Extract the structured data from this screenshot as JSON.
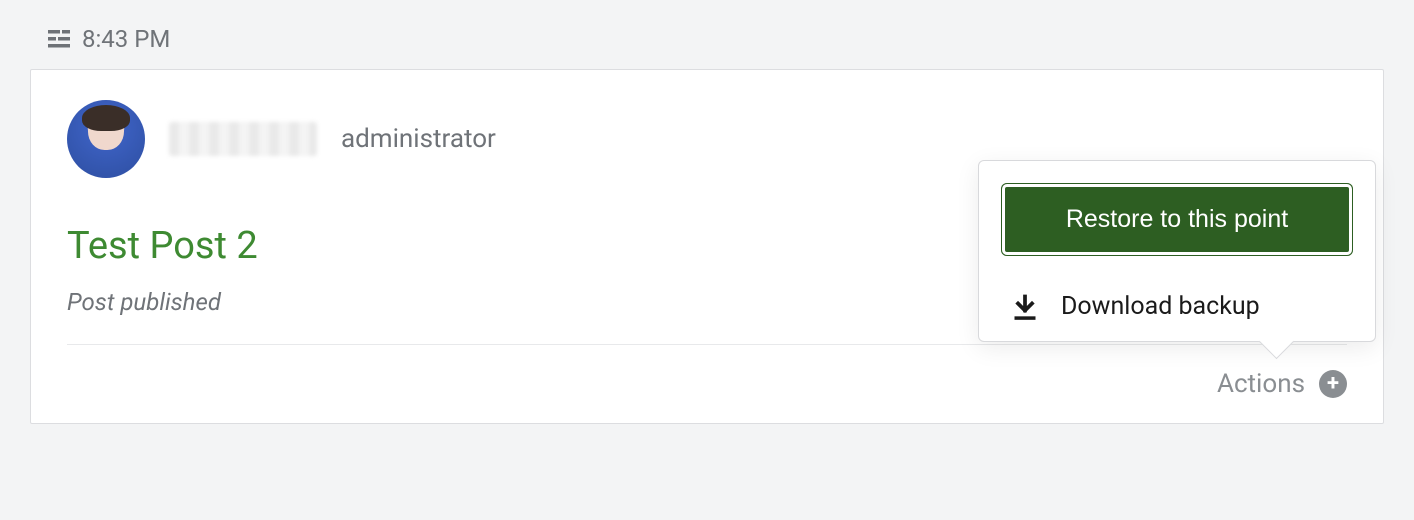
{
  "timeline": {
    "time": "8:43 PM"
  },
  "entry": {
    "author": {
      "role": "administrator"
    },
    "post_title": "Test Post 2",
    "status_text": "Post published",
    "actions_label": "Actions"
  },
  "popover": {
    "restore_label": "Restore to this point",
    "download_label": "Download backup"
  },
  "colors": {
    "accent_green": "#3e8a32",
    "button_green": "#2d5e22",
    "muted_text": "#6f7378"
  }
}
